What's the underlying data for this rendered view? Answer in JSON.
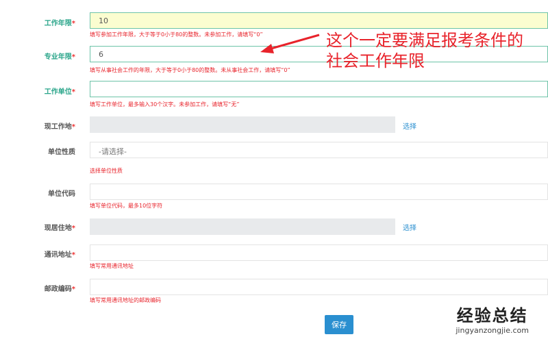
{
  "fields": [
    {
      "label": "工作年限",
      "required": "*",
      "value": "10",
      "hint": "填写参加工作年限，大于等于0小于80的整数。未参加工作，请填写“0”"
    },
    {
      "label": "专业年限",
      "required": "*",
      "value": "6",
      "hint": "填写从事社会工作的年限，大于等于0小于80的整数。未从事社会工作，请填写“0”"
    },
    {
      "label": "工作单位",
      "required": "*",
      "value": "",
      "hint": "填写工作单位，最多输入30个汉字。未参加工作，请填写“无”"
    },
    {
      "label": "现工作地",
      "required": "*",
      "pick": "选择"
    },
    {
      "label": "单位性质",
      "placeholder": "-请选择-",
      "hint": "选择单位性质"
    },
    {
      "label": "单位代码",
      "hint": "填写单位代码，最多10位字符"
    },
    {
      "label": "现居住地",
      "required": "*",
      "pick": "选择"
    },
    {
      "label": "通讯地址",
      "required": "*",
      "hint": "填写常用通讯地址"
    },
    {
      "label": "邮政编码",
      "required": "*",
      "hint": "填写常用通讯地址的邮政编码"
    }
  ],
  "save_label": "保存",
  "annotation": {
    "line1": "这个一定要满足报考条件的",
    "line2": "社会工作年限"
  },
  "watermark": {
    "title": "经验总结",
    "url": "jingyanzongjie.com"
  }
}
